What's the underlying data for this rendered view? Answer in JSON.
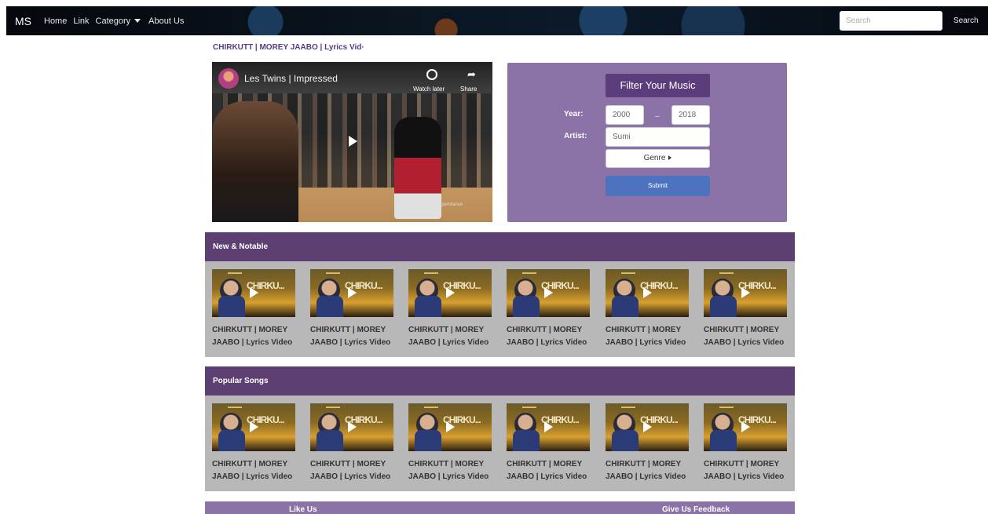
{
  "navbar": {
    "brand": "MS",
    "links": [
      "Home",
      "Link",
      "Category",
      "About Us"
    ],
    "search_placeholder": "Search",
    "search_button": "Search"
  },
  "page_title": "CHIRKUTT | MOREY JAABO | Lyrics Vid·",
  "video": {
    "title": "Les Twins | Impressed",
    "watch_later": "Watch later",
    "share": "Share",
    "watermark": "expertdance"
  },
  "filter": {
    "title": "Filter Your Music",
    "year_label": "Year:",
    "year_from": "2000",
    "year_dash": "–",
    "year_to": "2018",
    "artist_label": "Artist:",
    "artist_value": "Sumi",
    "genre_label": "Genre",
    "submit_label": "Submit"
  },
  "sections": [
    {
      "heading": "New & Notable",
      "cards": [
        {
          "title": "CHIRKUTT | MOREY JAABO | Lyrics Video"
        },
        {
          "title": "CHIRKUTT | MOREY JAABO | Lyrics Video"
        },
        {
          "title": "CHIRKUTT | MOREY JAABO | Lyrics Video"
        },
        {
          "title": "CHIRKUTT | MOREY JAABO | Lyrics Video"
        },
        {
          "title": "CHIRKUTT | MOREY JAABO | Lyrics Video"
        },
        {
          "title": "CHIRKUTT | MOREY JAABO | Lyrics Video"
        }
      ]
    },
    {
      "heading": "Popular Songs",
      "cards": [
        {
          "title": "CHIRKUTT | MOREY JAABO | Lyrics Video"
        },
        {
          "title": "CHIRKUTT | MOREY JAABO | Lyrics Video"
        },
        {
          "title": "CHIRKUTT | MOREY JAABO | Lyrics Video"
        },
        {
          "title": "CHIRKUTT | MOREY JAABO | Lyrics Video"
        },
        {
          "title": "CHIRKUTT | MOREY JAABO | Lyrics Video"
        },
        {
          "title": "CHIRKUTT | MOREY JAABO | Lyrics Video"
        }
      ]
    }
  ],
  "thumbnail_text": "CHIRKU...",
  "footer": {
    "like_us": "Like Us",
    "feedback": "Give Us Feedback"
  },
  "colors": {
    "accent_purple": "#5e3f73",
    "filter_panel": "#8b72a7",
    "submit_blue": "#4d73c0",
    "title_purple": "#5a3a8a"
  }
}
